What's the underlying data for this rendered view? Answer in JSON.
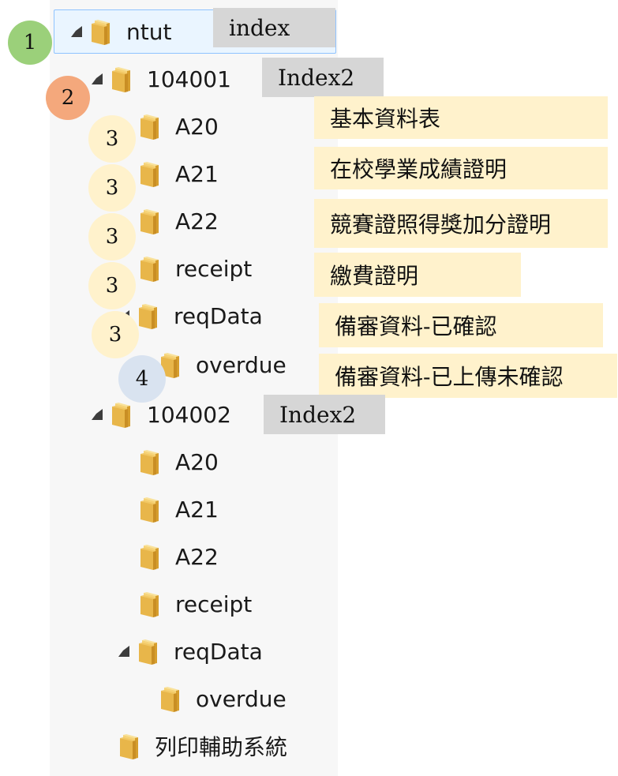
{
  "tree": {
    "root": "ntut",
    "n1": "104001",
    "n1_children": [
      "A20",
      "A21",
      "A22",
      "receipt",
      "reqData"
    ],
    "n1_req_child": "overdue",
    "n2": "104002",
    "n2_children": [
      "A20",
      "A21",
      "A22",
      "receipt",
      "reqData"
    ],
    "n2_req_child": "overdue",
    "last": "列印輔助系統"
  },
  "labels": {
    "root": "index",
    "n1": "Index2",
    "n2": "Index2",
    "notes": [
      "基本資料表",
      "在校學業成績證明",
      "競賽證照得獎加分證明",
      "繳費證明",
      "備審資料-已確認",
      "備審資料-已上傳未確認"
    ]
  },
  "badges": {
    "b1": "1",
    "b2": "2",
    "b3": "3",
    "b4": "4"
  },
  "colors": {
    "badge1": "#9bd07a",
    "badge2": "#f4a87c",
    "badge3": "#fff2cc",
    "badge4": "#d9e3f0",
    "gray_box": "#d6d6d6",
    "cream_box": "#fff2cc",
    "selection": "#eaf5ff",
    "selection_border": "#8fc3ff",
    "folder": "#e8b64a"
  }
}
